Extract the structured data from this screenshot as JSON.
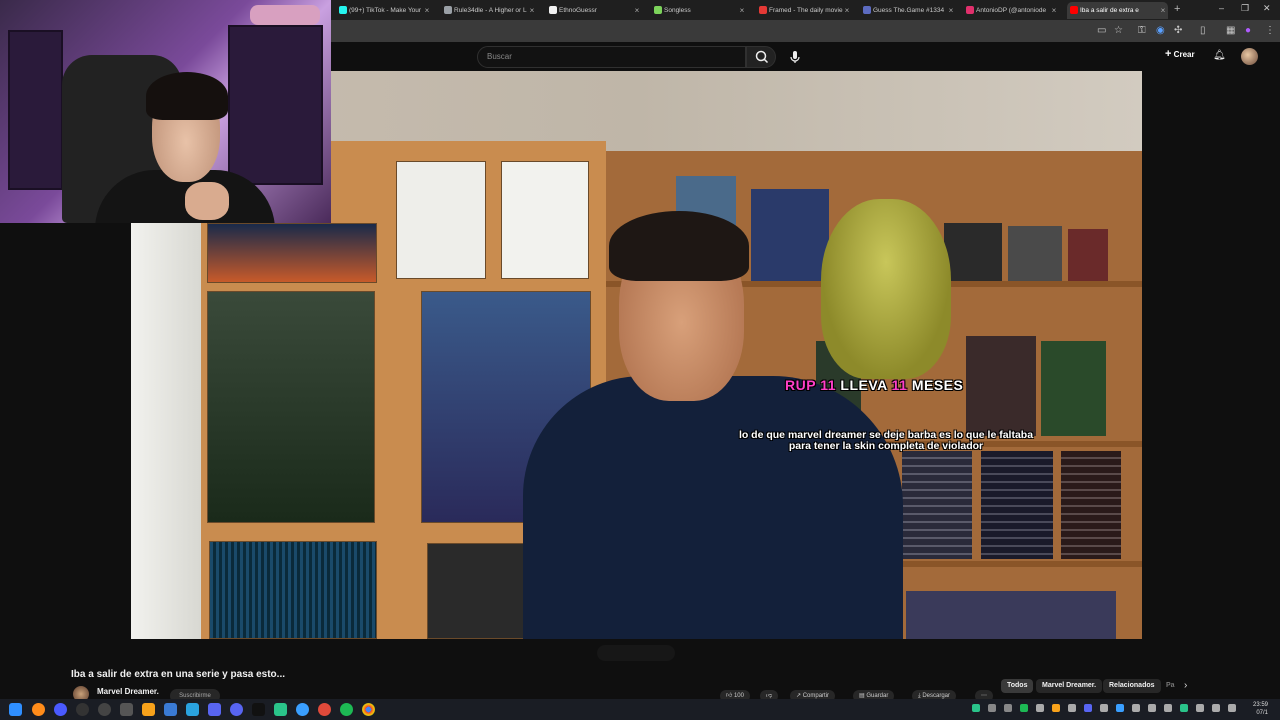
{
  "browser": {
    "tabs": [
      {
        "title": "(99+) TikTok - Make Your",
        "favicon_color": "#25f4ee",
        "active": false
      },
      {
        "title": "Rule34dle - A Higher or L",
        "favicon_color": "#9aa0a6",
        "active": false
      },
      {
        "title": "EthnoGuessr",
        "favicon_color": "#f1f1f1",
        "active": false
      },
      {
        "title": "Songless",
        "favicon_color": "#7cd35b",
        "active": false
      },
      {
        "title": "Framed - The daily movie",
        "favicon_color": "#e53935",
        "active": false
      },
      {
        "title": "Guess The.Game #1334",
        "favicon_color": "#5c6bc0",
        "active": false
      },
      {
        "title": "AntonioDP (@antoniode",
        "favicon_color": "#e1306c",
        "active": false
      },
      {
        "title": "Iba a salir de extra e",
        "favicon_color": "#ff0000",
        "active": true
      }
    ],
    "new_tab": "+",
    "window_controls": {
      "minimize": "–",
      "maximize": "❐",
      "close": "✕"
    }
  },
  "youtube": {
    "search": {
      "placeholder": "Buscar"
    },
    "create_label": "Crear",
    "video": {
      "title": "Iba a salir de extra en una serie y pasa esto...",
      "channel": "Marvel Dreamer.",
      "subscribe_label": "Suscribirme"
    },
    "chips": [
      "Todos",
      "Marvel Dreamer.",
      "Relacionados",
      "Pa"
    ],
    "actions": [
      "100",
      "",
      "Compartir",
      "Guardar",
      "Descargar"
    ]
  },
  "overlay": {
    "alert": {
      "user": "RUP",
      "count1": "11",
      "text1": "LLEVA",
      "count2": "11",
      "text2": "MESES"
    },
    "message": "lo de que marvel dreamer se deje barba es lo que le faltaba para tener la skin completa de violador"
  },
  "taskbar": {
    "time": "23:59",
    "date": "07/1"
  },
  "colors": {
    "alert_accent": "#ff3fc8",
    "youtube_red": "#ff0000",
    "background": "#0f0f0f"
  }
}
